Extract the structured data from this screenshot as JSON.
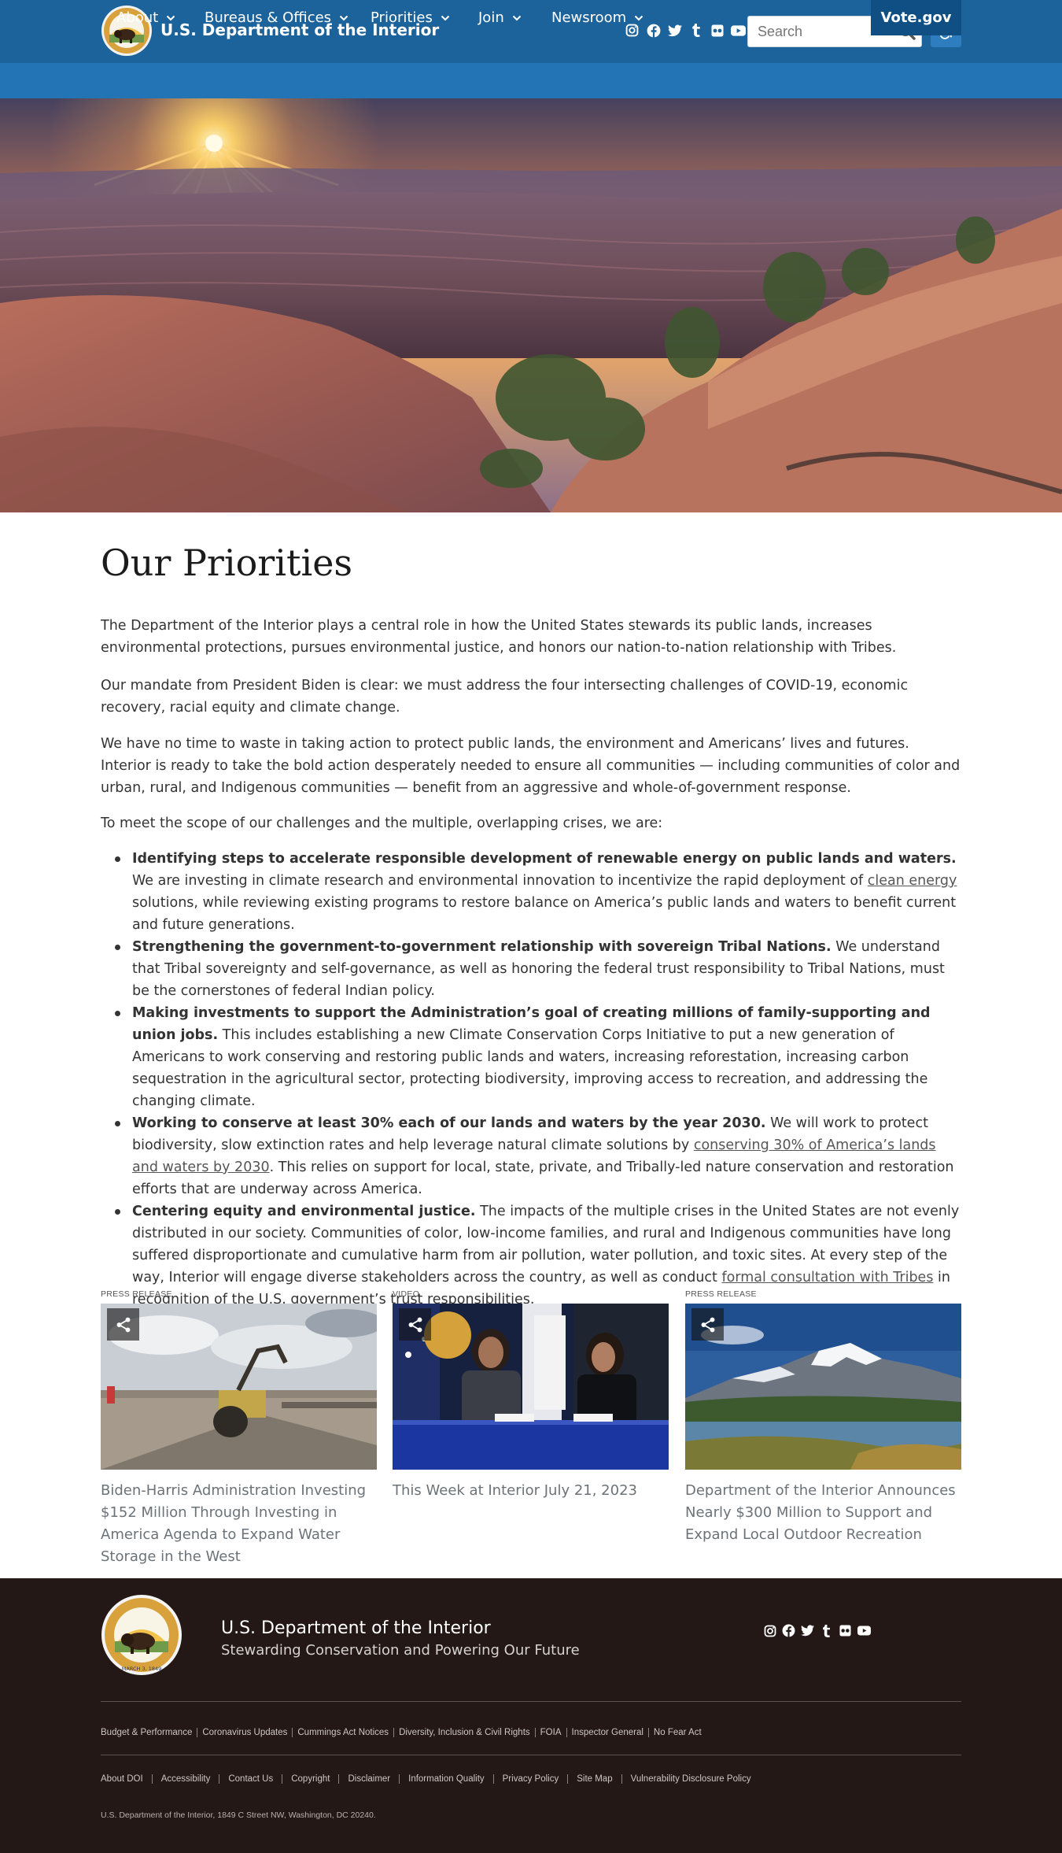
{
  "header": {
    "site_name": "U.S. Department of the Interior",
    "search_placeholder": "Search",
    "social_icons": [
      "instagram-icon",
      "facebook-icon",
      "twitter-icon",
      "tumblr-icon",
      "flickr-icon",
      "youtube-icon"
    ],
    "accessibility_icon": "wheelchair-icon",
    "colors": {
      "topbar": "#1d639b",
      "navbar": "#2374b4",
      "vote_button": "#0f4f84"
    }
  },
  "nav": {
    "items": [
      {
        "label": "About"
      },
      {
        "label": "Bureaus & Offices"
      },
      {
        "label": "Priorities"
      },
      {
        "label": "Join"
      },
      {
        "label": "Newsroom"
      }
    ],
    "vote_label": "Vote.gov"
  },
  "main": {
    "title": "Our Priorities",
    "paragraphs": [
      "The Department of the Interior plays a central role in how the United States stewards its public lands, increases environmental protections, pursues environmental justice, and honors our nation-to-nation relationship with Tribes.",
      "Our mandate from President Biden is clear: we must address the four intersecting challenges of COVID-19, economic recovery, racial equity and climate change.",
      "We have no time to waste in taking action to protect public lands, the environment and Americans’ lives and futures. Interior is ready to take the bold action desperately needed to ensure all communities — including communities of color and urban, rural, and Indigenous communities — benefit from an aggressive and whole-of-government response.",
      "To meet the scope of our challenges and the multiple, overlapping crises, we are:"
    ],
    "bullets": [
      {
        "bold": "Identifying steps to accelerate responsible development of renewable energy on public lands and waters.",
        "pre": " We are investing in climate research and environmental innovation to incentivize the rapid deployment of ",
        "link": "clean energy",
        "post": " solutions, while reviewing existing programs to restore balance on America’s public lands and waters to benefit current and future generations."
      },
      {
        "bold": "Strengthening the government-to-government relationship with sovereign Tribal Nations.",
        "pre": " We understand that Tribal sovereignty and self-governance, as well as honoring the federal trust responsibility to Tribal Nations, must be the cornerstones of federal Indian policy.",
        "link": "",
        "post": ""
      },
      {
        "bold": "Making investments to support the Administration’s goal of creating millions of family-supporting and union jobs.",
        "pre": " This includes establishing a new Climate Conservation Corps Initiative to put a new generation of Americans to work conserving and restoring public lands and waters, increasing reforestation, increasing carbon sequestration in the agricultural sector, protecting biodiversity, improving access to recreation, and addressing the changing climate.",
        "link": "",
        "post": ""
      },
      {
        "bold": "Working to conserve at least 30% each of our lands and waters by the year 2030.",
        "pre": " We will work to protect biodiversity, slow extinction rates and help leverage natural climate solutions by ",
        "link": "conserving 30% of America’s lands and waters by 2030",
        "post": ". This relies on support for local, state, private, and Tribally-led nature conservation and restoration efforts that are underway across America."
      },
      {
        "bold": "Centering equity and environmental justice.",
        "pre": " The impacts of the multiple crises in the United States are not evenly distributed in our society. Communities of color, low-income families, and rural and Indigenous communities have long suffered disproportionate and cumulative harm from air pollution, water pollution, and toxic sites. At every step of the way, Interior will engage diverse stakeholders across the country, as well as conduct ",
        "link": "formal consultation with Tribes",
        "post": " in recognition of the U.S. government’s trust responsibilities."
      }
    ]
  },
  "cards": [
    {
      "type": "PRESS RELEASE",
      "title": "Biden-Harris Administration Investing $152 Million Through Investing in America Agenda to Expand Water Storage in the West"
    },
    {
      "type": "VIDEO",
      "title": "This Week at Interior July 21, 2023"
    },
    {
      "type": "PRESS RELEASE",
      "title": "Department of the Interior Announces Nearly $300 Million to Support and Expand Local Outdoor Recreation"
    }
  ],
  "footer": {
    "name": "U.S. Department of the Interior",
    "tagline": "Stewarding Conservation and Powering Our Future",
    "links_row1": [
      "Budget & Performance",
      "Coronavirus Updates",
      "Cummings Act Notices",
      "Diversity, Inclusion & Civil Rights",
      "FOIA",
      "Inspector General",
      "No Fear Act"
    ],
    "links_row2": [
      "About DOI",
      "Accessibility",
      "Contact Us",
      "Copyright",
      "Disclaimer",
      "Information Quality",
      "Privacy Policy",
      "Site Map",
      "Vulnerability Disclosure Policy"
    ],
    "address": "U.S. Department of the Interior, 1849 C Street NW, Washington, DC 20240.",
    "seal_text": "MARCH 3, 1849",
    "background": "#231816"
  }
}
